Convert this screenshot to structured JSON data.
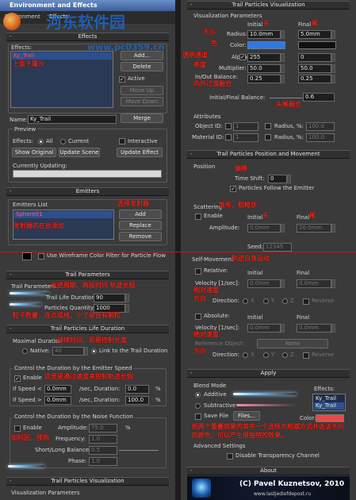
{
  "window": {
    "title": "Environment and Effects",
    "tab_env": "Environment",
    "tab_effects": "Effects"
  },
  "watermark": {
    "site_cn": "河东软件园",
    "url": "www.pc0359.cn"
  },
  "effects": {
    "rollout": "Effects",
    "group_label": "Effects:",
    "list_items": [
      "Ky_Trail"
    ],
    "note_list": "上面下属沙",
    "buttons": {
      "add": "Add...",
      "delete": "Delete",
      "move_up": "Move Up",
      "move_down": "Move Down",
      "merge": "Merge"
    },
    "active_label": "Active",
    "active_checked": true,
    "name_label": "Name:",
    "name_value": "Ky_Trail",
    "preview": {
      "label": "Preview",
      "effects_label": "Effects:",
      "all": "All",
      "current": "Current",
      "interactive": "Interactive",
      "show_original": "Show Original",
      "update_scene": "Update Scene",
      "update_effect": "Update Effect",
      "currently_updating": "Currently Updating:"
    }
  },
  "emitters": {
    "rollout": "Emitters",
    "list_label": "Emitters List",
    "items": [
      "Sphere01"
    ],
    "note_add": "选择发射器",
    "note_list": "发射器的在此添加",
    "buttons": {
      "add": "Add",
      "replace": "Replace",
      "remove": "Remove"
    },
    "wireframe_label": "Use Wireframe Color Filter for Particle Flow"
  },
  "parameters": {
    "rollout": "Trail Parameters",
    "label": "Trail Parameters",
    "note_top": "光迹周期，两段时间 轨迹长短",
    "life_label": "Trail Life Duration:",
    "life_value": "90",
    "qty_label": "Particles Quantity:",
    "qty_value": "1000",
    "note_bottom": "粒子数量，连点成线，少了就会有颗粒"
  },
  "life_duration": {
    "rollout": "Trail Particles Life Duration",
    "maximal_label": "Maximal Duration",
    "note_max": "持续时间，即是控制长度",
    "native_label": "Native:",
    "native_value": "40",
    "link_label": "Link to the Trail Duration",
    "speed_group": "Control the Duration by the Emitter Speed",
    "enable_label": "Enable",
    "note_speed": "这里是通过速度来控制轨迹长短",
    "if_speed_1": "If Speed <",
    "speed_1_value": "0.0mm",
    "speed_1_mid": "/sec, Duration:",
    "speed_1_dur": "0.0",
    "pct": "%",
    "if_speed_2": "If Speed >",
    "speed_2_value": "0.0mm",
    "speed_2_mid": "/sec, Duration:",
    "speed_2_dur": "100.0",
    "noise_group": "Control the Duration by the Noise Function",
    "noise_enable": "Enable",
    "amplitude_label": "Amplitude:",
    "amplitude_value": "75.0",
    "note_noise": "加科因，预热",
    "frequency_label": "Frequency:",
    "frequency_value": "1.0",
    "balance_label": "Short/Long Balance:",
    "balance_value": "0.5",
    "phase_label": "Phase:",
    "phase_value": "1.0"
  },
  "visualization_bottom": {
    "rollout": "Trail Particles Visualization",
    "label": "Visualization Parameters"
  },
  "visualization": {
    "rollout": "Trail Particles Visualization",
    "label": "Visualization Parameters",
    "initial": "Initial",
    "final": "Final",
    "note_initial": "头",
    "note_final": "尾",
    "radius_label": "Radius:",
    "radius_initial": "10.0mm",
    "radius_final": "5.0mm",
    "note_radius": "大小",
    "color_label": "Color:",
    "note_color": "色",
    "initial_color": "#2f78e8",
    "final_color": "#101010",
    "alpha_label": "Alpha:",
    "alpha_initial": "255",
    "alpha_final": "0",
    "note_alpha": "透明通道",
    "multiplier_label": "Multiplier:",
    "multiplier_initial": "50.0",
    "multiplier_final": "50.0",
    "note_multiplier": "亮度",
    "inout_label": "In/Out Balance:",
    "inout_initial": "0.25",
    "inout_final": "0.25",
    "note_inout": "内外过渡融合",
    "balance_label": "Initial/Final Balance:",
    "balance_value": "0.6",
    "note_balance": "头尾融合"
  },
  "attributes": {
    "label": "Attributes",
    "object_id": "Object ID:",
    "object_value": "1",
    "material_id": "Material ID:",
    "material_value": "1",
    "radius_pct": "Radius, %:",
    "radius_value": "100.0"
  },
  "position_movement": {
    "rollout": "Trail Particles Position and Movement",
    "position_label": "Position",
    "note_shift": "偏移",
    "time_shift_label": "Time Shift:",
    "time_shift_value": "0",
    "follow_label": "Particles Follow the Emitter",
    "scattering_label": "Scattering",
    "note_scatter": "散布，粗糙状",
    "enable_label": "Enable",
    "initial": "Initial",
    "final": "Final",
    "note_initial": "头",
    "note_final": "尾",
    "amplitude_label": "Amplitude:",
    "amp_initial": "0.0mm",
    "amp_final": "20.0mm",
    "seed_label": "Seed:",
    "seed_value": "12345",
    "self_movement_label": "Self-Movement",
    "note_self": "轨迹自身运动",
    "relative_label": "Relative:",
    "velocity_label": "Velocity [1/sec]:",
    "vel_initial": "0.0mm",
    "vel_final": "0.0mm",
    "note_relative": "相对速度",
    "direction_label": "Direction:",
    "note_direction": "方向",
    "axes": [
      "X",
      "Y",
      "Z"
    ],
    "reverse_label": "Reverse",
    "absolute_label": "Absolute:",
    "note_absolute": "绝对速度",
    "reference_label": "Reference Object:",
    "reference_value": "None"
  },
  "apply": {
    "rollout": "Apply",
    "blend_label": "Blend Mode",
    "additive": "Additive",
    "subtractive": "Subtractive",
    "save_file": "Save File",
    "files_button": "Files...",
    "effects_label": "Effects:",
    "effects_items": [
      "Ky_Trail",
      "Ky_Trail"
    ],
    "color_label": "Color:",
    "color_value": "#e84a4a",
    "note_blend": "把两个重叠效果的其中一个选择为相减方式并选该不同的颜色，可以产生很独特的效果。",
    "advanced_label": "Advanced Settings",
    "disable_label": "Disable Transparency Channel"
  },
  "about": {
    "rollout": "About",
    "copyright": "(C) Pavel Kuznetsov, 2010",
    "url": "www.lastjediofdepost.ru"
  }
}
